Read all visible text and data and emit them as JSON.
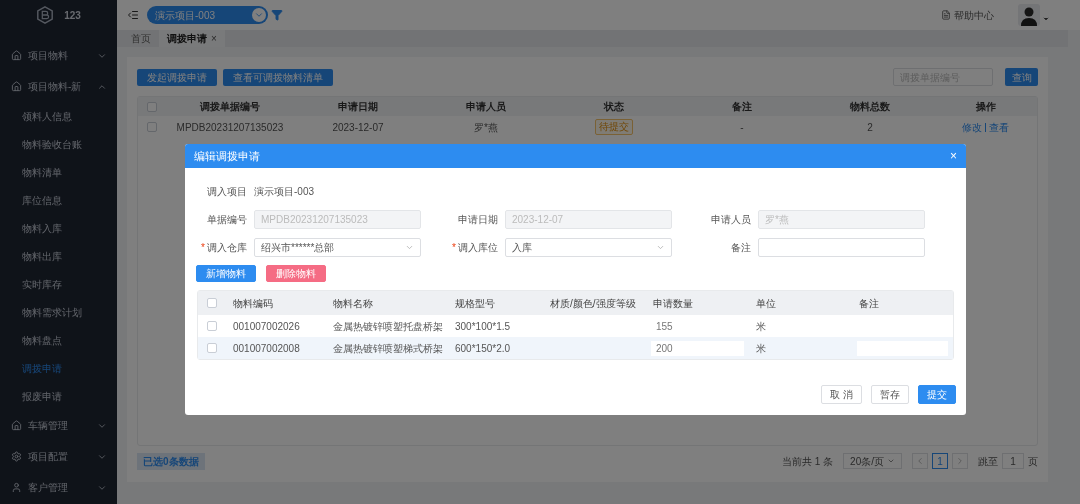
{
  "sidebar": {
    "logo_text": "123",
    "groups": [
      {
        "label": "项目物料",
        "expanded": false
      },
      {
        "label": "项目物料-新",
        "expanded": true,
        "children": [
          {
            "label": "领料人信息",
            "selected": false
          },
          {
            "label": "物料验收台账",
            "selected": false
          },
          {
            "label": "物料清单",
            "selected": false
          },
          {
            "label": "库位信息",
            "selected": false
          },
          {
            "label": "物料入库",
            "selected": false
          },
          {
            "label": "物料出库",
            "selected": false
          },
          {
            "label": "实时库存",
            "selected": false
          },
          {
            "label": "物料需求计划",
            "selected": false
          },
          {
            "label": "物料盘点",
            "selected": false
          },
          {
            "label": "调拨申请",
            "selected": true
          },
          {
            "label": "报废申请",
            "selected": false
          }
        ]
      },
      {
        "label": "车辆管理",
        "expanded": false
      },
      {
        "label": "项目配置",
        "expanded": false
      },
      {
        "label": "客户管理",
        "expanded": false
      }
    ]
  },
  "header": {
    "project": "演示项目-003",
    "help": "帮助中心"
  },
  "tabs": [
    {
      "label": "首页",
      "selected": false
    },
    {
      "label": "调拨申请",
      "selected": true,
      "close": "×"
    }
  ],
  "toolbar": {
    "buttons": [
      "发起调拨申请",
      "查看可调拨物料清单"
    ],
    "search_placeholder": "调拨单据编号",
    "search_button": "查询"
  },
  "table": {
    "header_checked": false,
    "columns": [
      "调拨单据编号",
      "申请日期",
      "申请人员",
      "状态",
      "备注",
      "物料总数",
      "操作"
    ],
    "rows": [
      {
        "checked": false,
        "cells": [
          "MPDB20231207135023",
          "2023-12-07",
          "罗*燕"
        ],
        "status": "待提交",
        "remark": "-",
        "total": "2",
        "actions": [
          "修改",
          "查看"
        ]
      }
    ]
  },
  "selection_info": "已选0条数据",
  "pagination": {
    "total": "当前共 1 条",
    "page_size": "20条/页",
    "pages": [
      {
        "label": "1",
        "selected": true
      }
    ],
    "jump_label": "跳至",
    "jump_value": "1",
    "page_unit": "页"
  },
  "dialog": {
    "title": "编辑调拨申请",
    "close": "×",
    "rows": [
      [
        {
          "kind": "text",
          "label": "调入项目",
          "value": "演示项目-003"
        }
      ],
      [
        {
          "kind": "input",
          "label": "单据编号",
          "value": "MPDB20231207135023",
          "disabled": true
        },
        {
          "kind": "input",
          "label": "申请日期",
          "value": "2023-12-07",
          "disabled": true
        },
        {
          "kind": "input",
          "label": "申请人员",
          "value": "罗*燕",
          "disabled": true
        }
      ],
      [
        {
          "kind": "select",
          "label": "调入仓库",
          "value": "绍兴市******总部",
          "marker": "*"
        },
        {
          "kind": "select",
          "label": "调入库位",
          "value": "入库",
          "marker": "*"
        },
        {
          "kind": "input",
          "label": "备注",
          "disabled": false
        }
      ]
    ],
    "actions": [
      {
        "label": "新增物料",
        "kind": "primary"
      },
      {
        "label": "删除物料",
        "kind": "danger"
      }
    ],
    "table": {
      "header_checked": false,
      "columns": [
        "物料编码",
        "物料名称",
        "规格型号",
        "材质/颜色/强度等级",
        "申请数量",
        "单位",
        "备注"
      ],
      "rows": [
        {
          "checked": false,
          "code": "001007002026",
          "name": "金属热镀锌喷塑托盘桥架",
          "spec": "300*100*1.5",
          "quantity": "155",
          "unit": "米",
          "editing": false
        },
        {
          "checked": false,
          "code": "001007002008",
          "name": "金属热镀锌喷塑梯式桥架",
          "spec": "600*150*2.0",
          "quantity": "200",
          "unit": "米",
          "editing": true
        }
      ]
    },
    "footer": [
      {
        "label": "取 消",
        "kind": "default"
      },
      {
        "label": "暂存",
        "kind": "default"
      },
      {
        "label": "提交",
        "kind": "primary"
      }
    ]
  }
}
